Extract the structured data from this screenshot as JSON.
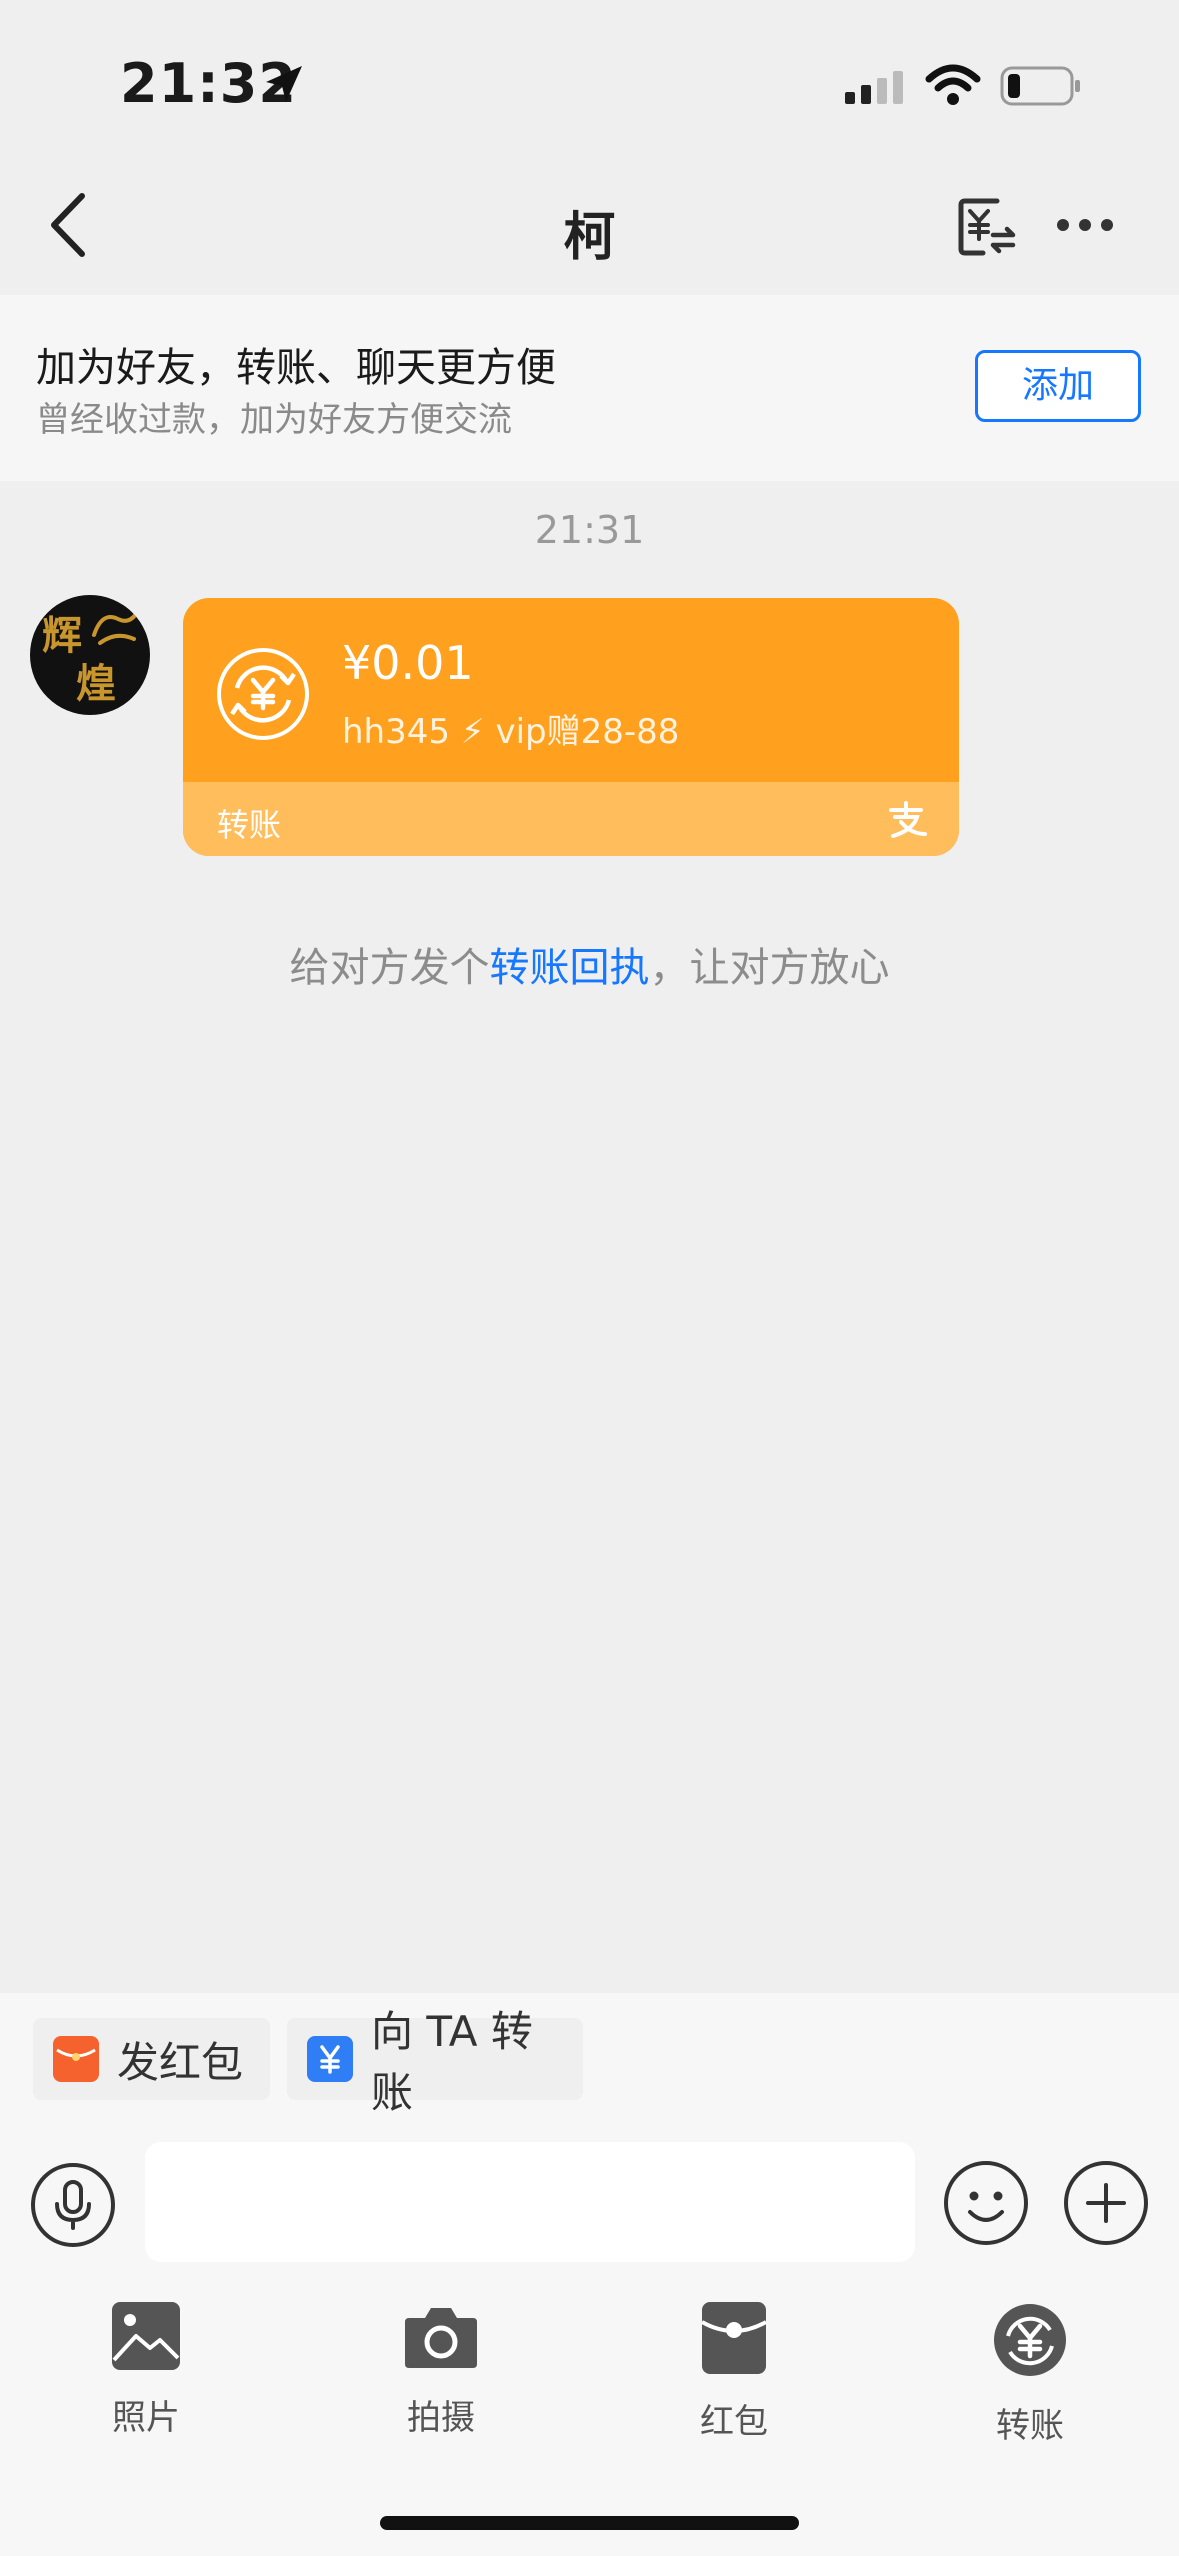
{
  "status_bar": {
    "time": "21:32"
  },
  "nav": {
    "title": "柯"
  },
  "banner": {
    "title": "加为好友，转账、聊天更方便",
    "subtitle": "曾经收过款，加为好友方便交流",
    "add_button": "添加"
  },
  "chat": {
    "timestamp": "21:31",
    "avatar_text": [
      "辉",
      "煌"
    ],
    "transfer_card": {
      "amount": "¥0.01",
      "note": "hh345 ⚡ vip赠28-88",
      "label": "转账"
    },
    "hint": {
      "before": "给对方发个",
      "link": "转账回执",
      "after": "，让对方放心"
    }
  },
  "quick_actions": [
    {
      "label": "发红包"
    },
    {
      "label": "向 TA 转账"
    }
  ],
  "toolbar": [
    {
      "label": "照片"
    },
    {
      "label": "拍摄"
    },
    {
      "label": "红包"
    },
    {
      "label": "转账"
    }
  ],
  "colors": {
    "accent_blue": "#1677ff",
    "transfer_orange": "#ffa01e",
    "transfer_orange_light": "#ffbd5c",
    "red_packet": "#f5622d",
    "transfer_blue": "#2f7ef5"
  }
}
